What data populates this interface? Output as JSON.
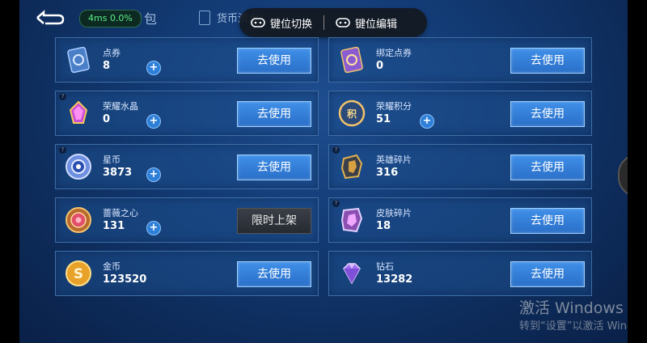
{
  "perf_indicator": "4ms 0.0%",
  "page_title": "货币背包",
  "tabs": {
    "currency_flow": "货币流水"
  },
  "key_menu": {
    "switch_label": "键位切换",
    "edit_label": "键位编辑"
  },
  "currencies_left": [
    {
      "name": "点券",
      "count": "8",
      "action": "去使用",
      "has_plus": true
    },
    {
      "name": "荣耀水晶",
      "count": "0",
      "action": "去使用",
      "has_plus": true
    },
    {
      "name": "星币",
      "count": "3873",
      "action": "去使用",
      "has_plus": true
    },
    {
      "name": "蔷薇之心",
      "count": "131",
      "action": "限时上架",
      "has_plus": true
    },
    {
      "name": "金币",
      "count": "123520",
      "action": "去使用",
      "has_plus": false
    }
  ],
  "currencies_right": [
    {
      "name": "绑定点券",
      "count": "0",
      "action": "去使用",
      "has_plus": false
    },
    {
      "name": "荣耀积分",
      "count": "51",
      "action": "去使用",
      "has_plus": true
    },
    {
      "name": "英雄碎片",
      "count": "316",
      "action": "去使用",
      "has_plus": false
    },
    {
      "name": "皮肤碎片",
      "count": "18",
      "action": "去使用",
      "has_plus": false
    },
    {
      "name": "钻石",
      "count": "13282",
      "action": "去使用",
      "has_plus": false
    }
  ],
  "watermark": {
    "line1": "激活 Windows",
    "line2": "转到“设置”以激活 Windows"
  },
  "colors": {
    "button_blue": "#2f7fd8",
    "panel_blue": "#1e4e8c",
    "perf_green": "#5cf08a"
  }
}
